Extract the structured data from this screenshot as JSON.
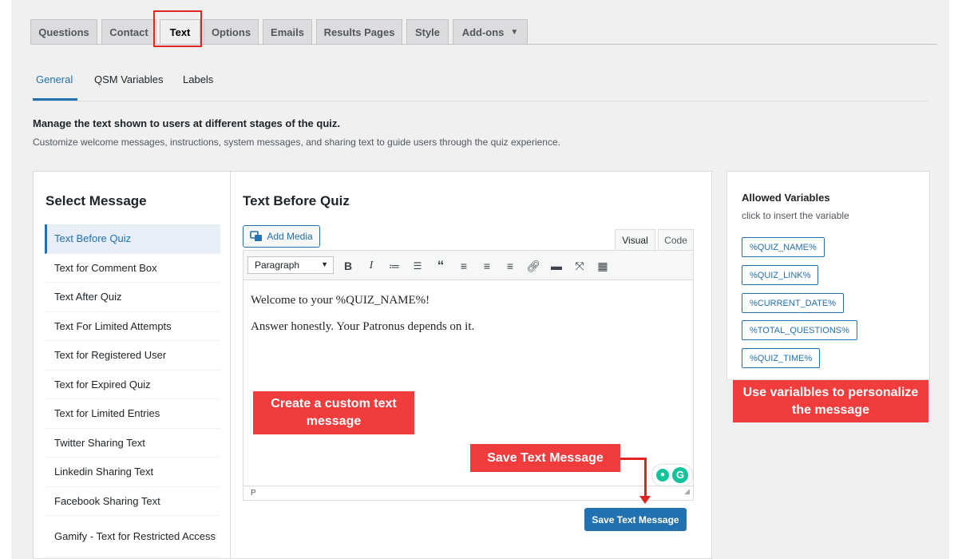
{
  "tabs": [
    {
      "label": "Questions"
    },
    {
      "label": "Contact"
    },
    {
      "label": "Text"
    },
    {
      "label": "Options"
    },
    {
      "label": "Emails"
    },
    {
      "label": "Results Pages"
    },
    {
      "label": "Style"
    },
    {
      "label": "Add-ons"
    }
  ],
  "subtabs": [
    "General",
    "QSM Variables",
    "Labels"
  ],
  "description": {
    "title": "Manage the text shown to users at different stages of the quiz.",
    "subtitle": "Customize welcome messages, instructions, system messages, and sharing text to guide users through the quiz experience."
  },
  "select_message": {
    "title": "Select Message",
    "items": [
      "Text Before Quiz",
      "Text for Comment Box",
      "Text After Quiz",
      "Text For Limited Attempts",
      "Text for Registered User",
      "Text for Expired Quiz",
      "Text for Limited Entries",
      "Twitter Sharing Text",
      "Linkedin Sharing Text",
      "Facebook Sharing Text",
      "Gamify - Text for Restricted Access"
    ],
    "active_index": 0
  },
  "editor": {
    "title": "Text Before Quiz",
    "add_media": "Add Media",
    "mode_visual": "Visual",
    "mode_code": "Code",
    "format": "Paragraph",
    "content": [
      "Welcome to your %QUIZ_NAME%!",
      "Answer honestly. Your Patronus depends on it."
    ],
    "status_path": "P",
    "save_label": "Save Text Message"
  },
  "variables": {
    "title": "Allowed Variables",
    "subtitle": "click to insert the variable",
    "items": [
      "%QUIZ_NAME%",
      "%QUIZ_LINK%",
      "%CURRENT_DATE%",
      "%TOTAL_QUESTIONS%",
      "%QUIZ_TIME%"
    ]
  },
  "annotations": {
    "custom_text": "Create a custom text message",
    "save_text": "Save Text Message",
    "variables_hint": "Use varialbles to personalize the message"
  },
  "colors": {
    "accent": "#2271b1",
    "annotation": "#f03c3c",
    "highlight_border": "#e02424"
  }
}
